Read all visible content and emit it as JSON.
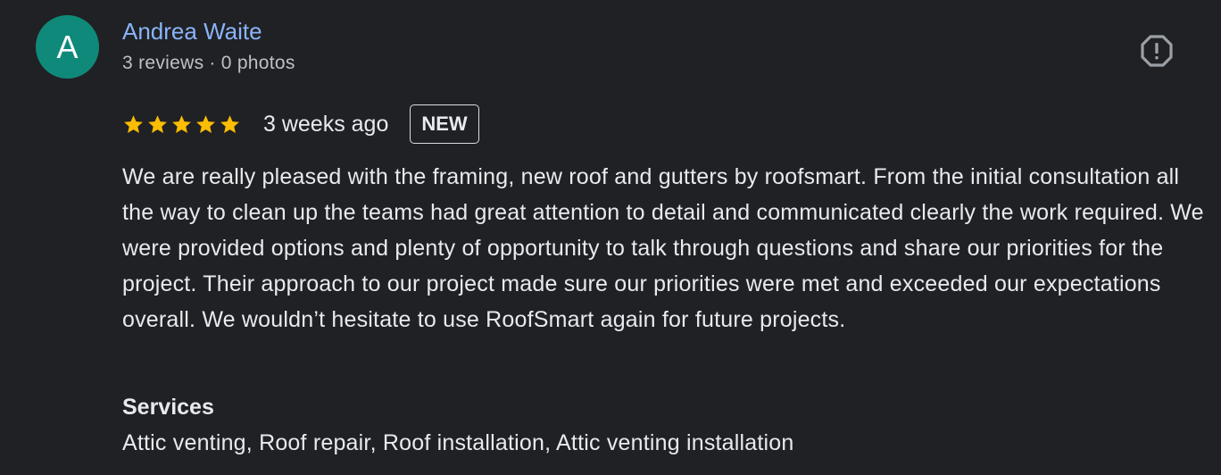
{
  "reviewer": {
    "avatar_letter": "A",
    "avatar_color": "#0f8a7a",
    "name": "Andrea Waite",
    "reviews_count": "3 reviews",
    "separator": "·",
    "photos_count": "0 photos"
  },
  "report": {
    "icon": "report-flag-octagon-icon"
  },
  "rating": {
    "stars": 5,
    "max_stars": 5,
    "star_color": "#fbbc04",
    "time_ago": "3 weeks ago",
    "badge": "NEW"
  },
  "review": {
    "text": "We are really pleased with the framing, new roof and gutters by roofsmart. From the initial consultation all the way to clean up the teams had great attention to detail and communicated clearly the work required. We were provided options and plenty of opportunity to talk through questions and share our priorities for the project. Their approach to our project made sure our priorities were met and exceeded our expectations overall. We wouldn’t hesitate to use RoofSmart again for future projects."
  },
  "services": {
    "heading": "Services",
    "list": "Attic venting, Roof repair, Roof installation, Attic venting installation"
  }
}
